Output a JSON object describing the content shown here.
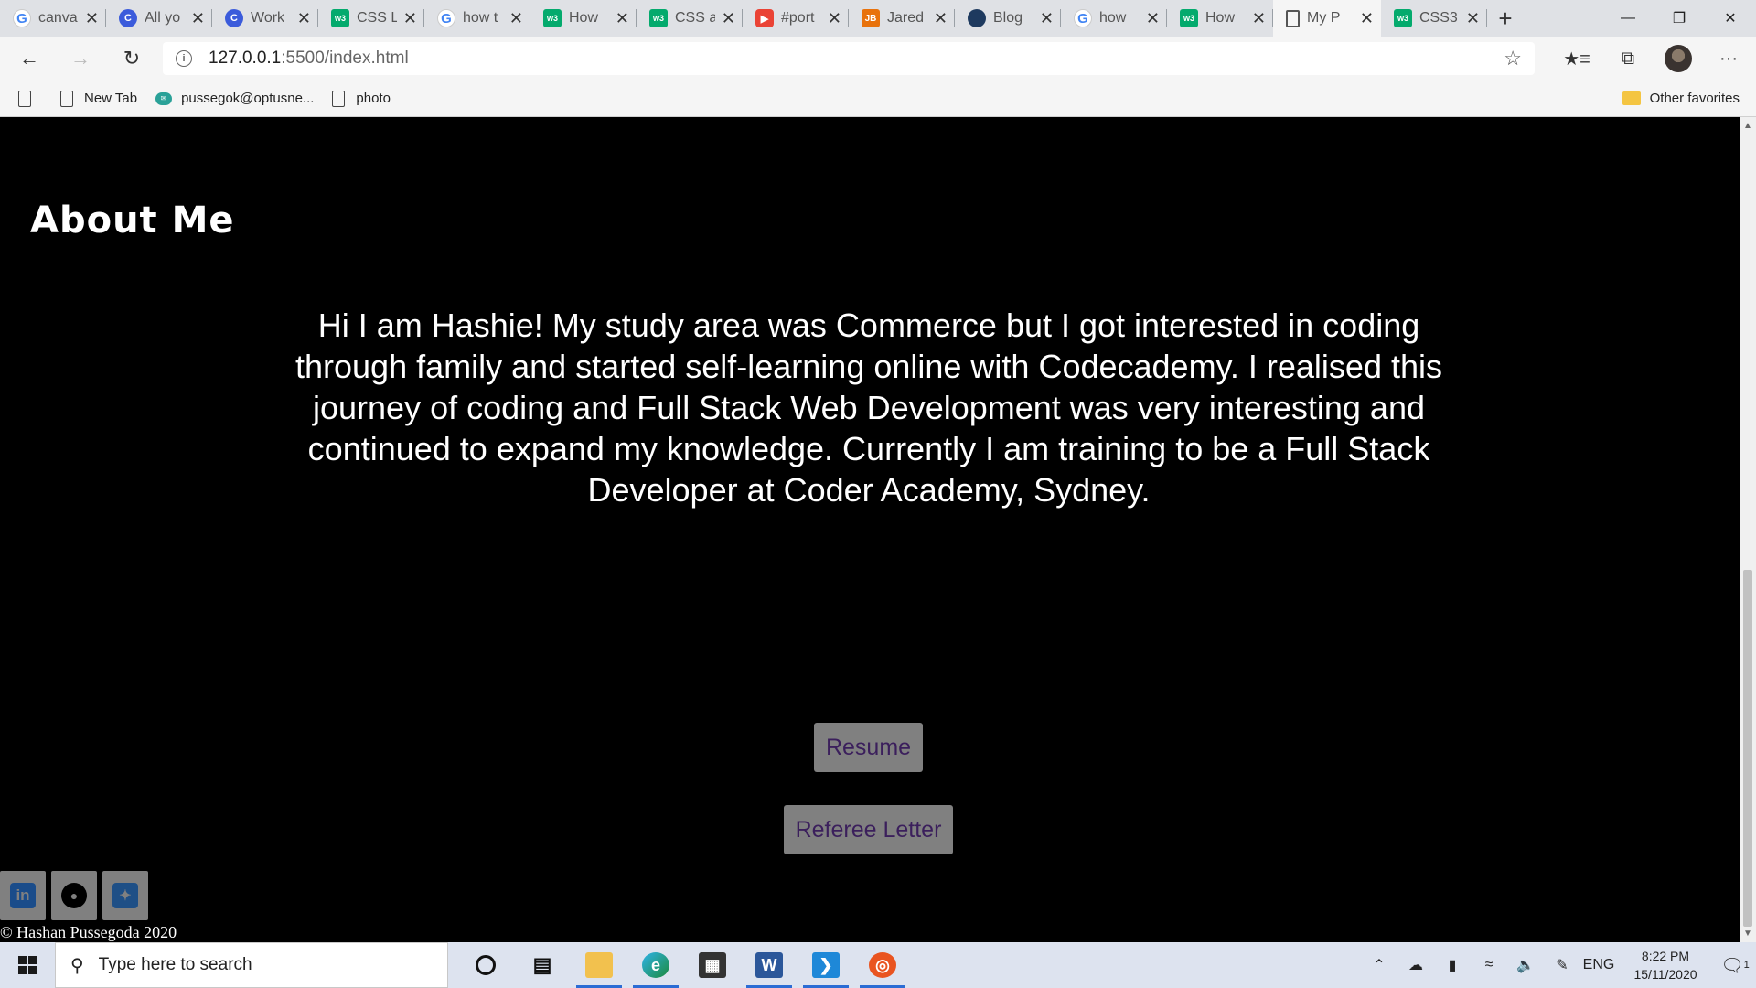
{
  "browser": {
    "tabs": [
      {
        "favicon": "google-icon",
        "title": "canva"
      },
      {
        "favicon": "c-icon",
        "title": "All yo"
      },
      {
        "favicon": "c-icon",
        "title": "Work"
      },
      {
        "favicon": "w3-icon",
        "title": "CSS L"
      },
      {
        "favicon": "google-icon",
        "title": "how t"
      },
      {
        "favicon": "w3-icon",
        "title": "How"
      },
      {
        "favicon": "w3-icon",
        "title": "CSS a"
      },
      {
        "favicon": "youtube-icon",
        "title": "#port"
      },
      {
        "favicon": "jb-icon",
        "title": "Jared"
      },
      {
        "favicon": "blog-icon",
        "title": "Blog"
      },
      {
        "favicon": "google-icon",
        "title": "how"
      },
      {
        "favicon": "w3-icon",
        "title": "How"
      },
      {
        "favicon": "page-icon",
        "title": "My P",
        "active": true
      },
      {
        "favicon": "w3-icon",
        "title": "CSS3"
      }
    ],
    "new_tab_symbol": "+",
    "address": {
      "host": "127.0.0.1",
      "path": ":5500/index.html"
    },
    "bookmarks": [
      {
        "icon": "page-icon",
        "label": ""
      },
      {
        "icon": "page-icon",
        "label": "New Tab"
      },
      {
        "icon": "mail-icon",
        "label": "pussegok@optusne..."
      },
      {
        "icon": "page-icon",
        "label": "photo"
      }
    ],
    "other_favorites": "Other favorites"
  },
  "page": {
    "heading": "About Me",
    "about_text": "Hi I am Hashie! My study area was Commerce but I got interested in coding through family and started self-learning online with Codecademy. I realised this journey of coding and Full Stack Web Development was very interesting and continued to expand my knowledge. Currently I am training to be a Full Stack Developer at Coder Academy, Sydney.",
    "buttons": {
      "resume": "Resume",
      "referee": "Referee Letter"
    },
    "socials": {
      "linkedin": "in",
      "github": "gh",
      "twitter": "t"
    },
    "copyright": "© Hashan Pussegoda 2020"
  },
  "taskbar": {
    "search_placeholder": "Type here to search",
    "language": "ENG",
    "time": "8:22 PM",
    "date": "15/11/2020",
    "notification_count": "1"
  }
}
